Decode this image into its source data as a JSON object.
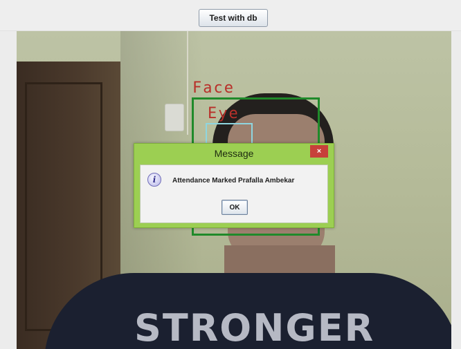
{
  "toolbar": {
    "test_button_label": "Test with db"
  },
  "camera_feed": {
    "face_label": "Face",
    "eye_label": "Eye",
    "shirt_text": "STRONGER",
    "face_box_color": "#1f8a2a",
    "eye_box_color": "#8ed6e0",
    "label_color": "#b8302a"
  },
  "dialog": {
    "title": "Message",
    "close_label": "×",
    "icon": "info-icon",
    "icon_glyph": "i",
    "message": "Attendance Marked Prafalla Ambekar",
    "ok_label": "OK",
    "title_bar_color": "#9ccf52",
    "close_color": "#c7403a"
  }
}
